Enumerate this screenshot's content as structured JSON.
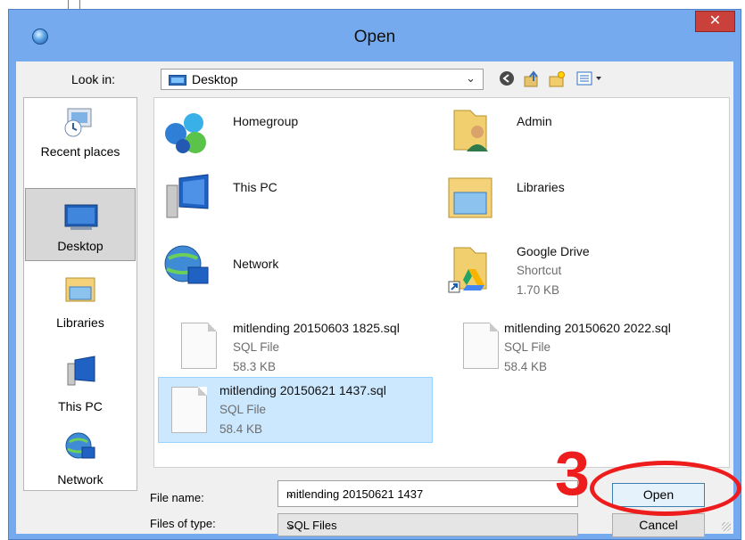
{
  "window": {
    "title": "Open",
    "close_glyph": "✕"
  },
  "toolbar": {
    "look_in_label": "Look in:",
    "look_in_value": "Desktop",
    "chevron": "⌄"
  },
  "places": [
    {
      "label": "Recent places",
      "icon": "recent-places-icon"
    },
    {
      "label": "Desktop",
      "icon": "desktop-icon",
      "selected": true
    },
    {
      "label": "Libraries",
      "icon": "libraries-icon"
    },
    {
      "label": "This PC",
      "icon": "this-pc-icon"
    },
    {
      "label": "Network",
      "icon": "network-icon"
    }
  ],
  "files": [
    {
      "name": "Homegroup",
      "icon": "homegroup-icon"
    },
    {
      "name": "Admin",
      "icon": "user-folder-icon"
    },
    {
      "name": "This PC",
      "icon": "this-pc-icon"
    },
    {
      "name": "Libraries",
      "icon": "libraries-icon"
    },
    {
      "name": "Network",
      "icon": "network-icon"
    },
    {
      "name": "Google Drive",
      "type": "Shortcut",
      "size": "1.70 KB",
      "icon": "google-drive-shortcut-icon"
    },
    {
      "name": "mitlending 20150603 1825.sql",
      "type": "SQL File",
      "size": "58.3 KB",
      "icon": "sql-file-icon"
    },
    {
      "name": "mitlending 20150620 2022.sql",
      "type": "SQL File",
      "size": "58.4 KB",
      "icon": "sql-file-icon"
    },
    {
      "name": "mitlending 20150621 1437.sql",
      "type": "SQL File",
      "size": "58.4 KB",
      "icon": "sql-file-icon",
      "selected": true
    }
  ],
  "form": {
    "file_name_label": "File name:",
    "file_name_value": "mitlending 20150621 1437",
    "file_type_label": "Files of type:",
    "file_type_value": "SQL Files",
    "open_button": "Open",
    "cancel_button": "Cancel"
  },
  "annotation": {
    "step_number": "3",
    "color": "#ee1d1d"
  }
}
